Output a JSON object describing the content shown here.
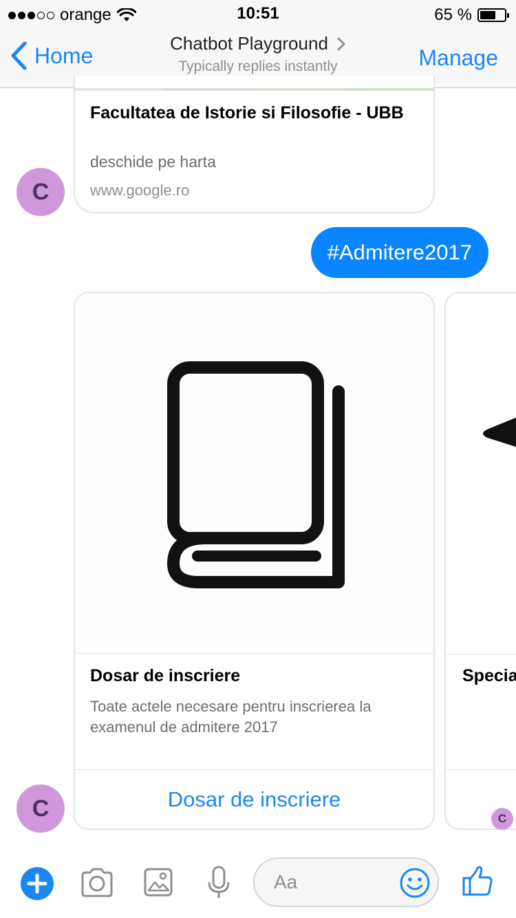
{
  "status_bar": {
    "carrier": "orange",
    "time": "10:51",
    "battery_percent": "65 %",
    "battery_level": 0.65
  },
  "nav": {
    "back_label": "Home",
    "title": "Chatbot Playground",
    "subtitle": "Typically replies instantly",
    "manage_label": "Manage"
  },
  "messages": {
    "map_card": {
      "title": "Facultatea de Istorie si Filosofie - UBB",
      "subtitle": "deschide pe harta",
      "url": "www.google.ro"
    },
    "sent": {
      "text": "#Admitere2017"
    },
    "carousel": [
      {
        "image_icon": "book-icon",
        "title": "Dosar de inscriere",
        "description": "Toate actele necesare pentru inscrierea la examenul de admitere 2017",
        "button_label": "Dosar de inscriere"
      },
      {
        "image_icon": "arrow-icon",
        "title": "Specia"
      }
    ],
    "avatar_initial": "C"
  },
  "composer": {
    "placeholder": "Aa",
    "icons": [
      "plus-icon",
      "camera-icon",
      "image-icon",
      "microphone-icon",
      "emoji-icon",
      "thumbs-up-icon"
    ]
  },
  "colors": {
    "accent": "#1a87f5",
    "sent_bubble": "#0a84ff",
    "avatar_bg": "#cf98db",
    "avatar_text": "#4e2f5f"
  }
}
